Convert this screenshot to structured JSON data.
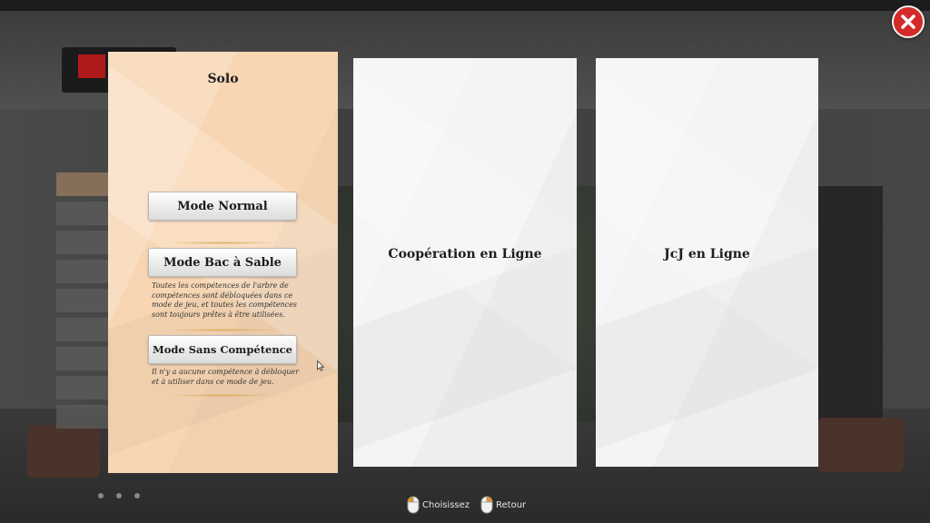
{
  "panels": {
    "solo": {
      "title": "Solo",
      "modes": [
        {
          "label": "Mode Normal",
          "description": ""
        },
        {
          "label": "Mode Bac à Sable",
          "description": "Toutes les compétences de l'arbre de compétences sont débloquées dans ce mode de jeu, et toutes les compétences sont toujours prêtes à être utilisées."
        },
        {
          "label": "Mode Sans Compétence",
          "description": "Il n'y a aucune compétence à débloquer et à utiliser dans ce mode de jeu."
        }
      ]
    },
    "coop": {
      "title": "Coopération en Ligne"
    },
    "pvp": {
      "title": "JcJ en Ligne"
    }
  },
  "footer": {
    "select_label": "Choisissez",
    "back_label": "Retour"
  },
  "icons": {
    "close": "close-icon",
    "left_click": "mouse-left-click-icon",
    "right_click": "mouse-right-click-icon"
  },
  "colors": {
    "solo_panel": "#f8d6b3",
    "other_panel": "#f4f4f4",
    "close_button": "#d42a2a",
    "mouse_highlight": "#e0922e"
  }
}
